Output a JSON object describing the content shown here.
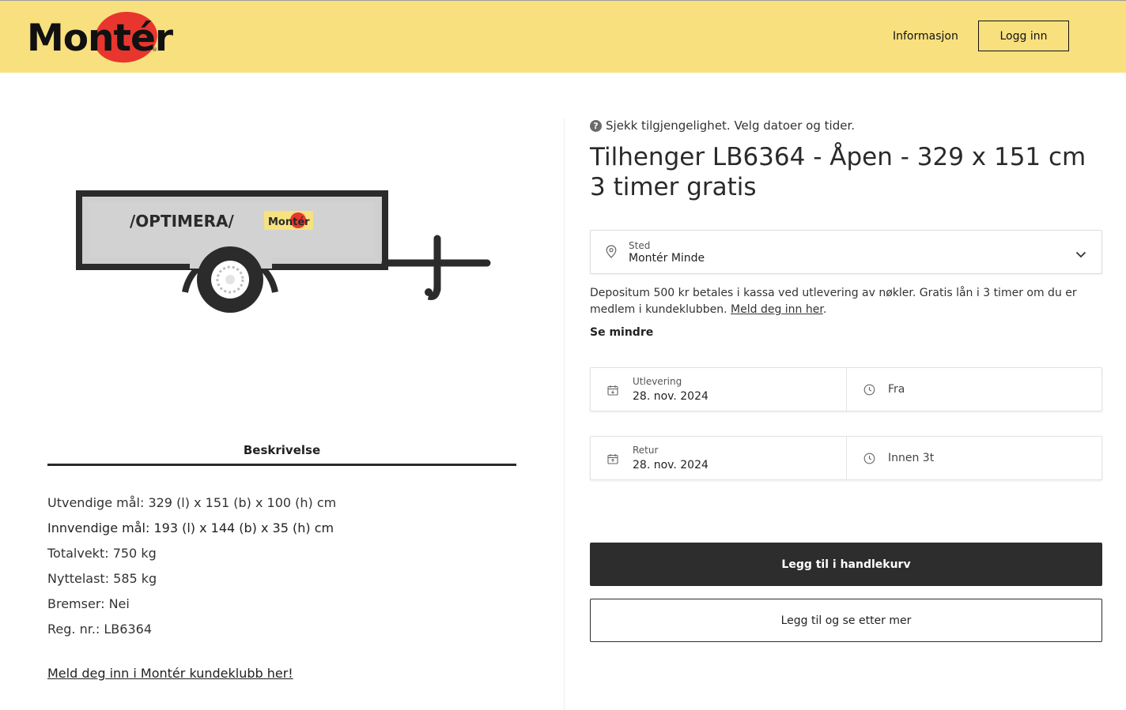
{
  "header": {
    "logo_text": "Montér",
    "logo_reg": "®",
    "nav_info": "Informasjon",
    "login_label": "Logg inn"
  },
  "product_image": {
    "brand_text": "/OPTIMERA/",
    "badge_text": "Montér"
  },
  "description": {
    "tab_label": "Beskrivelse",
    "specs": [
      "Utvendige mål: 329 (l) x 151 (b) x 100 (h) cm",
      "Innvendige mål: 193 (l) x 144 (b) x 35 (h) cm",
      "Totalvekt: 750 kg",
      "Nyttelast: 585 kg",
      "Bremser: Nei",
      "Reg. nr.: LB6364"
    ],
    "club_link": "Meld deg inn i Montér kundeklubb her!"
  },
  "booking": {
    "help_icon": "?",
    "availability_note": "Sjekk tilgjengelighet. Velg datoer og tider.",
    "title_line1": "Tilhenger LB6364 - Åpen - 329 x 151 cm",
    "title_line2": "3 timer gratis",
    "location": {
      "label": "Sted",
      "value": "Montér Minde"
    },
    "deposit_text": "Depositum 500 kr betales i kassa ved utlevering av nøkler. Gratis lån i 3 timer om du er medlem i kundeklubben.",
    "deposit_link": "Meld deg inn her",
    "deposit_end": ".",
    "see_less": "Se mindre",
    "pickup": {
      "label": "Utlevering",
      "date": "28. nov. 2024",
      "time": "Fra"
    },
    "return": {
      "label": "Retur",
      "date": "28. nov. 2024",
      "time": "Innen 3t"
    },
    "add_to_cart": "Legg til i handlekurv",
    "add_and_browse": "Legg til og se etter mer"
  },
  "colors": {
    "header_bg": "#f9e07f",
    "logo_red": "#e8362e",
    "primary_button": "#2d2d2d"
  }
}
